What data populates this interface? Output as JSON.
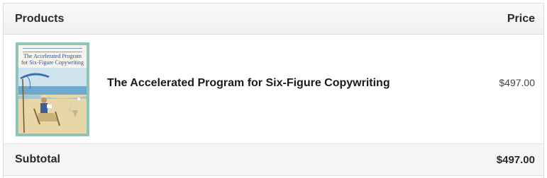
{
  "table": {
    "header": {
      "products_label": "Products",
      "price_label": "Price"
    },
    "items": [
      {
        "name": "The Accelerated Program for Six-Figure Copywriting",
        "price": "$497.00",
        "thumbnail": {
          "title_line1": "The Accelerated Program",
          "title_line2": "for Six-Figure Copywriting",
          "icon": "book-cover-image",
          "frame_color": "#8fc4b9"
        }
      }
    ],
    "subtotal": {
      "label": "Subtotal",
      "value": "$497.00"
    }
  }
}
